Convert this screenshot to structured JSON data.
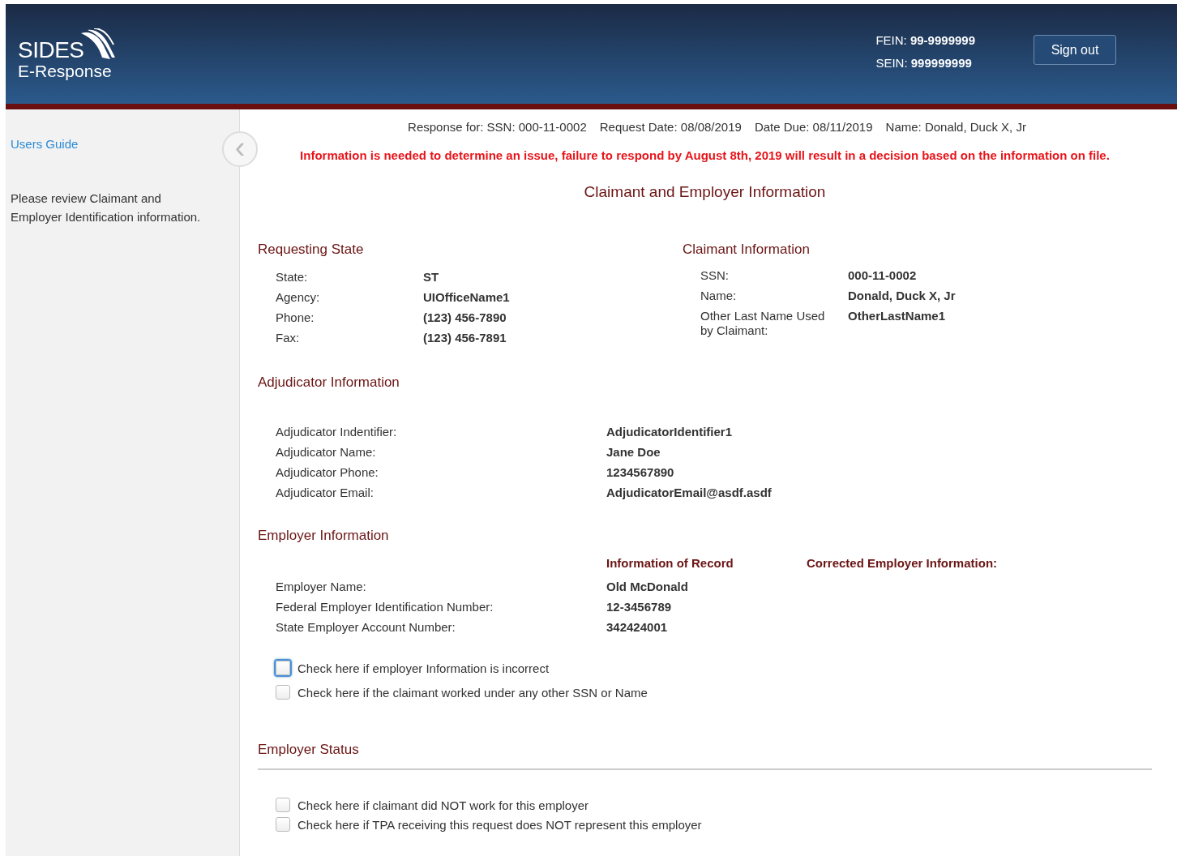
{
  "header": {
    "logo_top": "SIDES",
    "logo_bottom": "E-Response",
    "fein_label": "FEIN:",
    "fein": "99-9999999",
    "sein_label": "SEIN:",
    "sein": "999999999",
    "sign_out": "Sign out"
  },
  "sidebar": {
    "link": "Users Guide",
    "collapse_icon": "‹",
    "note": "Please review Claimant and Employer Identification information."
  },
  "summary": [
    "Response for: SSN: 000-11-0002",
    "Request Date: 08/08/2019",
    "Date Due: 08/11/2019",
    "Name: Donald, Duck X, Jr"
  ],
  "warning": "Information is needed to determine an issue, failure to respond by August 8th, 2019 will result in a decision based on the information on file.",
  "title": "Claimant and Employer Information",
  "requesting_state": {
    "heading": "Requesting State",
    "rows": [
      {
        "label": "State:",
        "value": "ST"
      },
      {
        "label": "Agency:",
        "value": "UIOfficeName1"
      },
      {
        "label": "Phone:",
        "value": "(123) 456-7890"
      },
      {
        "label": "Fax:",
        "value": "(123) 456-7891"
      }
    ]
  },
  "claimant": {
    "heading": "Claimant Information",
    "rows": [
      {
        "label": "SSN:",
        "value": "000-11-0002"
      },
      {
        "label": "Name:",
        "value": "Donald, Duck X, Jr"
      },
      {
        "label": "Other Last Name Used by Claimant:",
        "value": "OtherLastName1"
      }
    ]
  },
  "adjudicator": {
    "heading": "Adjudicator Information",
    "rows": [
      {
        "label": "Adjudicator Indentifier:",
        "value": "AdjudicatorIdentifier1"
      },
      {
        "label": "Adjudicator Name:",
        "value": "Jane Doe"
      },
      {
        "label": "Adjudicator Phone:",
        "value": "1234567890"
      },
      {
        "label": "Adjudicator Email:",
        "value": "AdjudicatorEmail@asdf.asdf"
      }
    ]
  },
  "employer": {
    "heading": "Employer Information",
    "record_heading": "Information of Record",
    "corrected_heading": "Corrected Employer Information:",
    "rows": [
      {
        "label": "Employer Name:",
        "value": "Old McDonald"
      },
      {
        "label": "Federal Employer Identification Number:",
        "value": "12-3456789"
      },
      {
        "label": "State Employer Account Number:",
        "value": "342424001"
      }
    ],
    "checks": [
      {
        "label": "Check here if employer Information is incorrect",
        "checked": false,
        "focused": true
      },
      {
        "label": "Check here if the claimant worked under any other SSN or Name",
        "checked": false,
        "focused": false
      }
    ]
  },
  "employer_status": {
    "heading": "Employer Status",
    "checks": [
      {
        "label": "Check here if claimant did NOT work for this employer",
        "checked": false,
        "focused": false
      },
      {
        "label": "Check here if TPA receiving this request does NOT represent this employer",
        "checked": false,
        "focused": false
      }
    ]
  }
}
